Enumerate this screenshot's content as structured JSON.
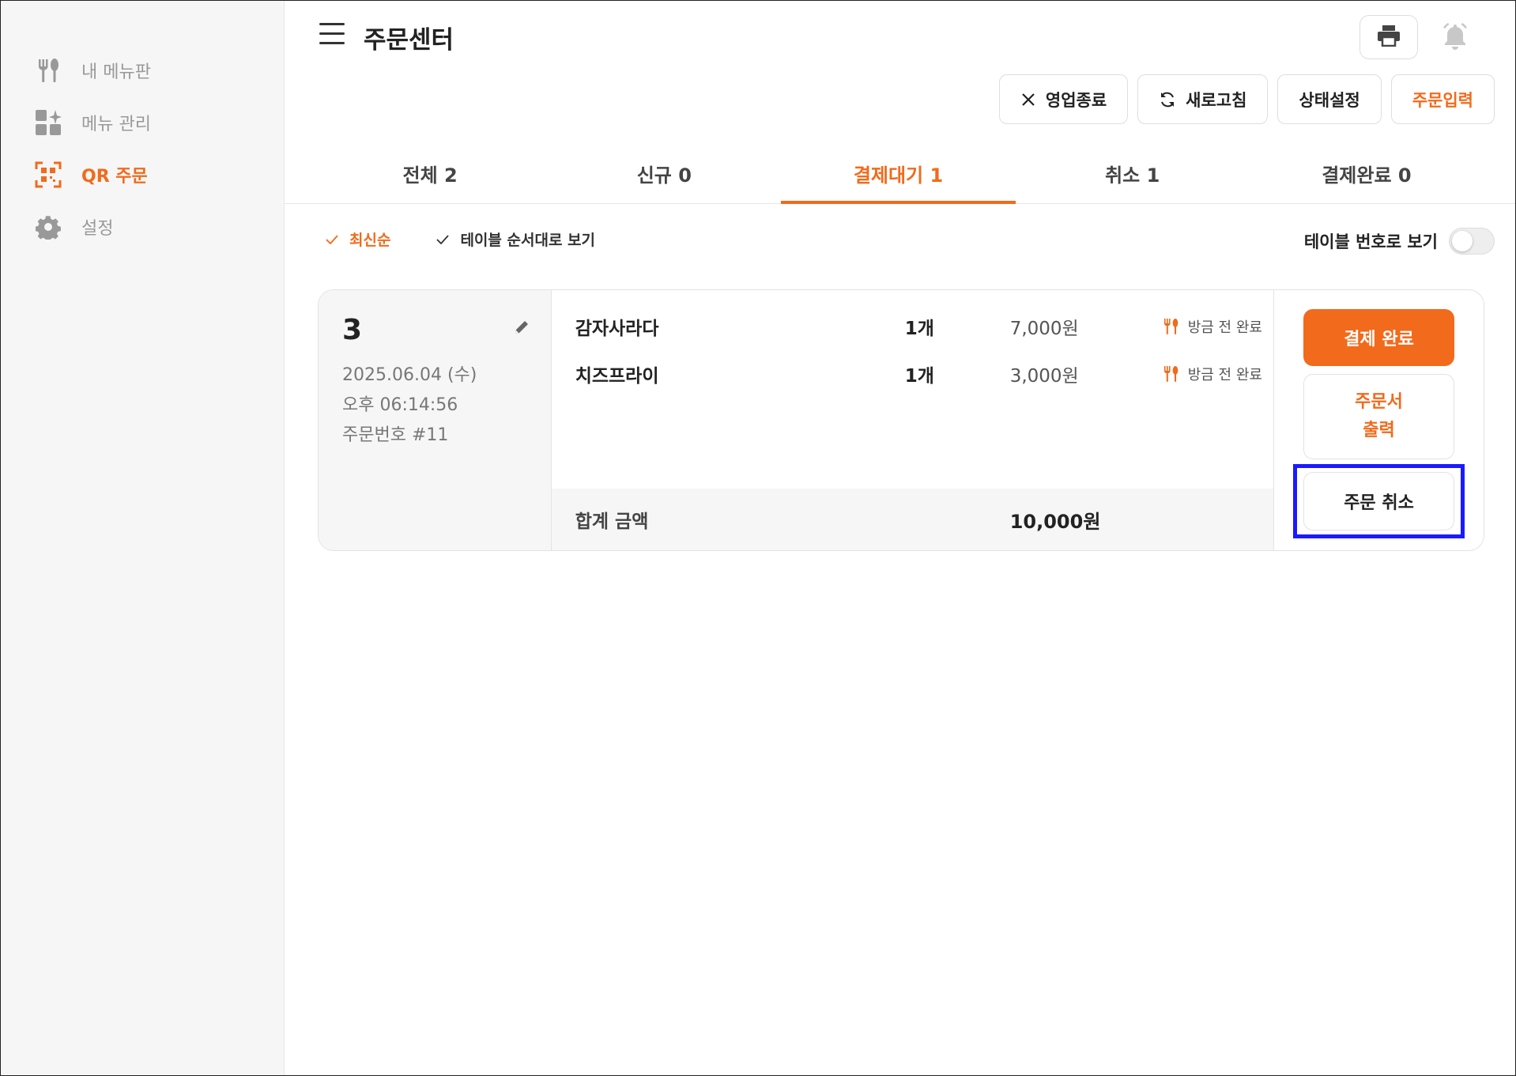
{
  "sidebar": {
    "items": [
      {
        "label": "내 메뉴판",
        "icon": "utensils-icon",
        "active": false
      },
      {
        "label": "메뉴 관리",
        "icon": "grid-sparkle-icon",
        "active": false
      },
      {
        "label": "QR 주문",
        "icon": "qr-scan-icon",
        "active": true
      },
      {
        "label": "설정",
        "icon": "gear-icon",
        "active": false
      }
    ]
  },
  "header": {
    "title": "주문센터",
    "icons": [
      "menu-icon",
      "printer-icon",
      "bell-icon"
    ]
  },
  "actions": {
    "close_business": "영업종료",
    "refresh": "새로고침",
    "status_settings": "상태설정",
    "order_input": "주문입력"
  },
  "tabs": [
    {
      "label": "전체 2",
      "active": false
    },
    {
      "label": "신규 0",
      "active": false
    },
    {
      "label": "결제대기 1",
      "active": true
    },
    {
      "label": "취소 1",
      "active": false
    },
    {
      "label": "결제완료 0",
      "active": false
    }
  ],
  "filters": {
    "latest": "최신순",
    "table_order": "테이블 순서대로 보기"
  },
  "toggle": {
    "label": "테이블 번호로 보기",
    "on": false
  },
  "order": {
    "table_no": "3",
    "date": "2025.06.04 (수)",
    "time": "오후 06:14:56",
    "order_no": "주문번호 #11",
    "items": [
      {
        "name": "감자사라다",
        "qty": "1개",
        "price": "7,000원",
        "status": "방금 전 완료"
      },
      {
        "name": "치즈프라이",
        "qty": "1개",
        "price": "3,000원",
        "status": "방금 전 완료"
      }
    ],
    "total_label": "합계 금액",
    "total_value": "10,000원",
    "buttons": {
      "pay_complete": "결제 완료",
      "print_receipt": "주문서\n출력",
      "cancel_order": "주문 취소"
    }
  },
  "colors": {
    "accent": "#f26a1b",
    "highlight_box": "#1a1aff"
  }
}
